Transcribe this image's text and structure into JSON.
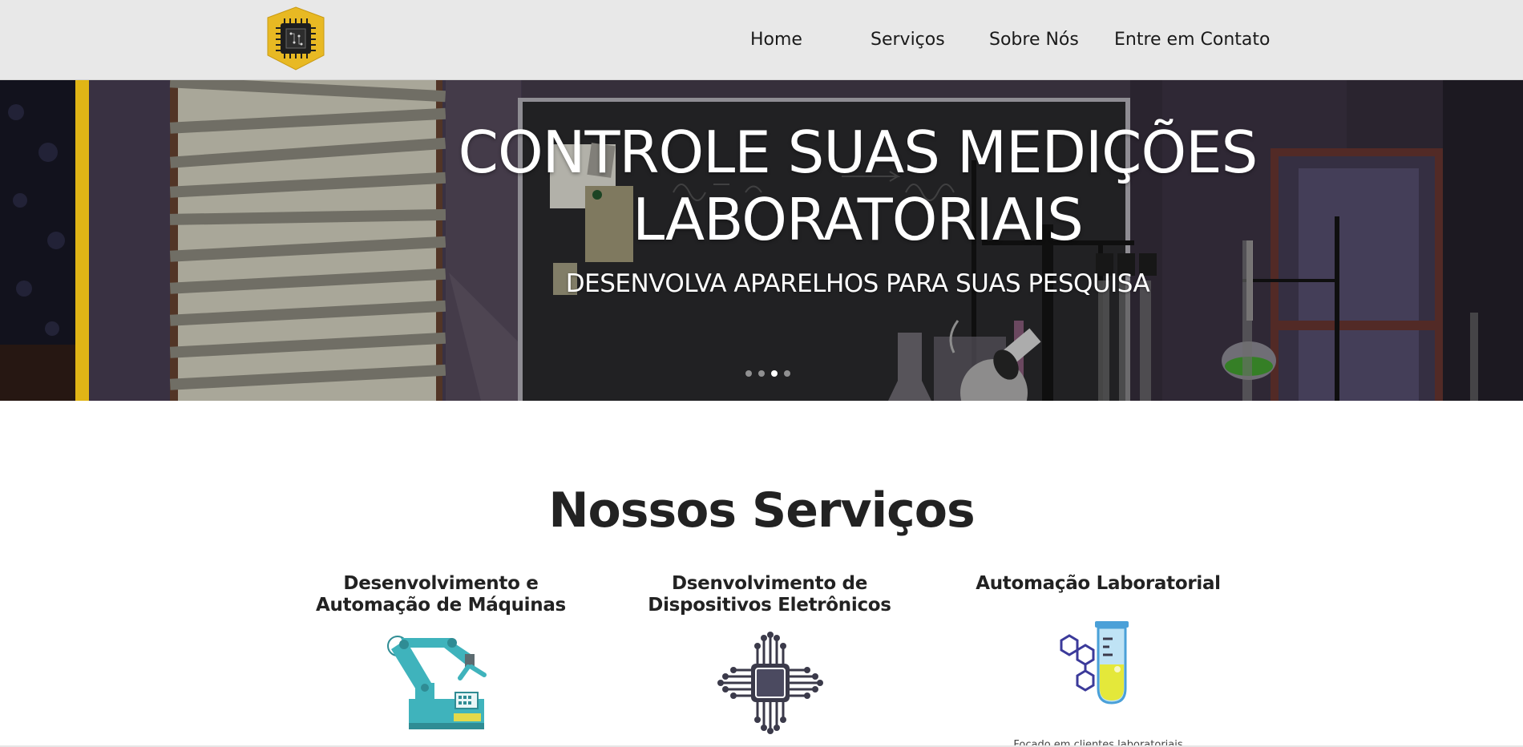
{
  "nav": {
    "home": "Home",
    "servicos": "Serviços",
    "sobre": "Sobre Nós",
    "contato": "Entre em Contato"
  },
  "hero": {
    "title": "CONTROLE SUAS MEDIÇÕES LABORATORIAIS",
    "subtitle": "DESENVOLVA APARELHOS PARA SUAS PESQUISA",
    "slides": 4,
    "active_slide": 3
  },
  "services": {
    "title": "Nossos Serviços",
    "items": [
      {
        "title": "Desenvolvimento e Automação de Máquinas",
        "icon": "robot-arm-icon"
      },
      {
        "title": "Dsenvolvimento de Dispositivos Eletrônicos",
        "icon": "microchip-icon"
      },
      {
        "title": "Automação Laboratorial",
        "icon": "test-tube-molecule-icon",
        "description": "Focado em clientes laboratoriais"
      }
    ]
  },
  "colors": {
    "navbar_bg": "#e8e8e8",
    "logo_yellow": "#e8b923",
    "accent_yellow": "#f5c518",
    "hero_bg": "#3a3340",
    "robot_teal": "#3fb3bc"
  }
}
